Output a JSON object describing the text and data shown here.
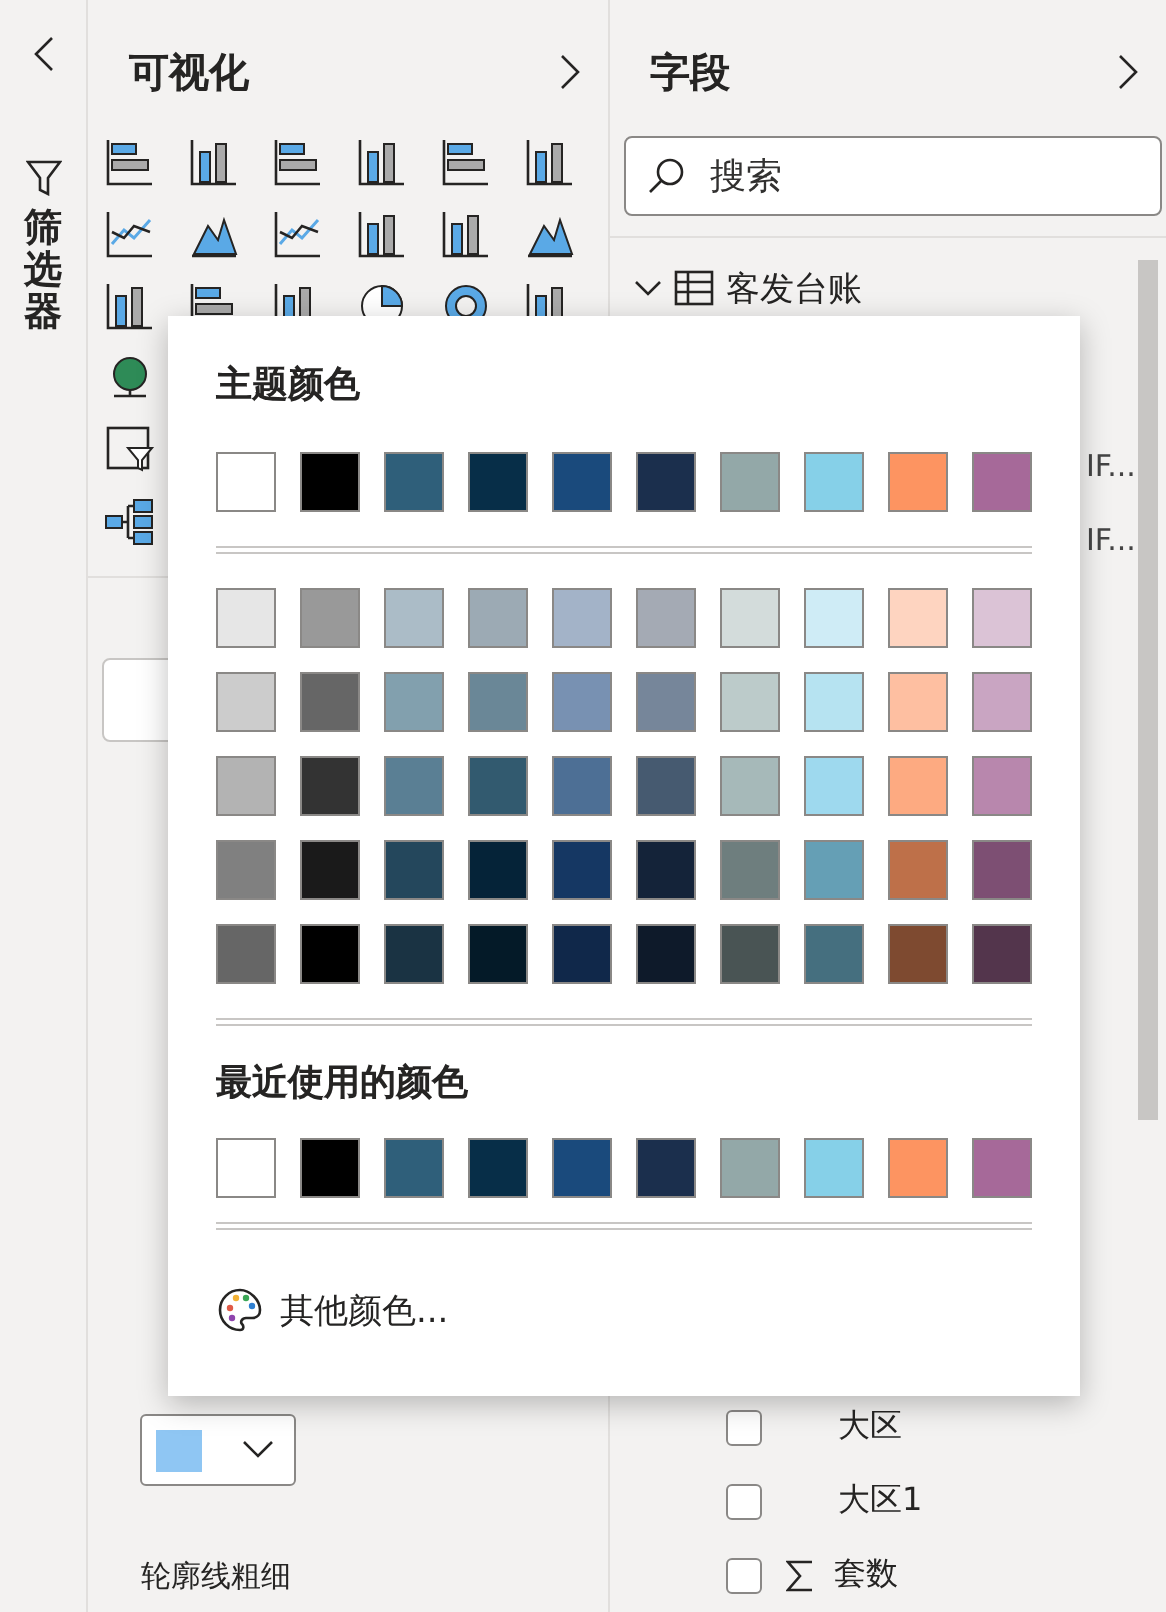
{
  "filter_pane": {
    "title": "筛选器"
  },
  "visualizations": {
    "title": "可视化",
    "outline_color": {
      "color": "#8fc6f3"
    },
    "outline_width_label": "轮廓线粗细"
  },
  "fields": {
    "title": "字段",
    "search": {
      "placeholder": "搜索"
    },
    "table": {
      "name": "客发台账",
      "expanded": true
    },
    "top_rows": [
      {
        "kind": "covered",
        "label": "IF..."
      },
      {
        "kind": "covered",
        "label": "IF..."
      }
    ],
    "bottom_rows": [
      {
        "kind": "field",
        "label": "大区",
        "checked": false
      },
      {
        "kind": "field",
        "label": "大区1",
        "checked": false
      },
      {
        "kind": "measure",
        "label": "套数",
        "checked": false
      }
    ]
  },
  "color_popup": {
    "theme_title": "主题颜色",
    "theme_colors": [
      {
        "color": "#ffffff"
      },
      {
        "color": "#000000"
      },
      {
        "color": "#2f5f7a"
      },
      {
        "color": "#072e48"
      },
      {
        "color": "#1a4a7c"
      },
      {
        "color": "#1b2f4d"
      },
      {
        "color": "#93a8a8"
      },
      {
        "color": "#86d0e8"
      },
      {
        "color": "#fd9461"
      },
      {
        "color": "#a66999"
      }
    ],
    "shades": [
      [
        {
          "color": "#e6e6e6"
        },
        {
          "color": "#999999"
        },
        {
          "color": "#abbcc7"
        },
        {
          "color": "#9caab4"
        },
        {
          "color": "#a3b3c8"
        },
        {
          "color": "#a4aab4"
        },
        {
          "color": "#d3dcdb"
        },
        {
          "color": "#cfecf6"
        },
        {
          "color": "#fed4c0"
        },
        {
          "color": "#dbc3d6"
        }
      ],
      [
        {
          "color": "#cccccc"
        },
        {
          "color": "#666666"
        },
        {
          "color": "#82a0ae"
        },
        {
          "color": "#6a8797"
        },
        {
          "color": "#7891b2"
        },
        {
          "color": "#76869a"
        },
        {
          "color": "#bccbca"
        },
        {
          "color": "#b6e3f1"
        },
        {
          "color": "#febfa1"
        },
        {
          "color": "#c9a5c2"
        }
      ],
      [
        {
          "color": "#b3b3b3"
        },
        {
          "color": "#333333"
        },
        {
          "color": "#5a7f94"
        },
        {
          "color": "#325a6f"
        },
        {
          "color": "#4d6f95"
        },
        {
          "color": "#465a70"
        },
        {
          "color": "#a6b9b9"
        },
        {
          "color": "#9ed9ee"
        },
        {
          "color": "#fdaa81"
        },
        {
          "color": "#b887ad"
        }
      ],
      [
        {
          "color": "#808080"
        },
        {
          "color": "#1a1a1a"
        },
        {
          "color": "#24475c"
        },
        {
          "color": "#052338"
        },
        {
          "color": "#153763"
        },
        {
          "color": "#142339"
        },
        {
          "color": "#6e7e7e"
        },
        {
          "color": "#659fb5"
        },
        {
          "color": "#be7049"
        },
        {
          "color": "#7d4f73"
        }
      ],
      [
        {
          "color": "#666666"
        },
        {
          "color": "#000000"
        },
        {
          "color": "#1a3343"
        },
        {
          "color": "#041a28"
        },
        {
          "color": "#10284a"
        },
        {
          "color": "#0e1a2a"
        },
        {
          "color": "#495454"
        },
        {
          "color": "#456f7f"
        },
        {
          "color": "#7e4a30"
        },
        {
          "color": "#53354c"
        }
      ]
    ],
    "recent_title": "最近使用的颜色",
    "recent_colors": [
      {
        "color": "#ffffff"
      },
      {
        "color": "#000000"
      },
      {
        "color": "#2f5f7a"
      },
      {
        "color": "#072e48"
      },
      {
        "color": "#1a4a7c"
      },
      {
        "color": "#1b2f4d"
      },
      {
        "color": "#93a8a8"
      },
      {
        "color": "#86d0e8"
      },
      {
        "color": "#fd9461"
      },
      {
        "color": "#a66999"
      }
    ],
    "more_colors": "其他颜色..."
  }
}
